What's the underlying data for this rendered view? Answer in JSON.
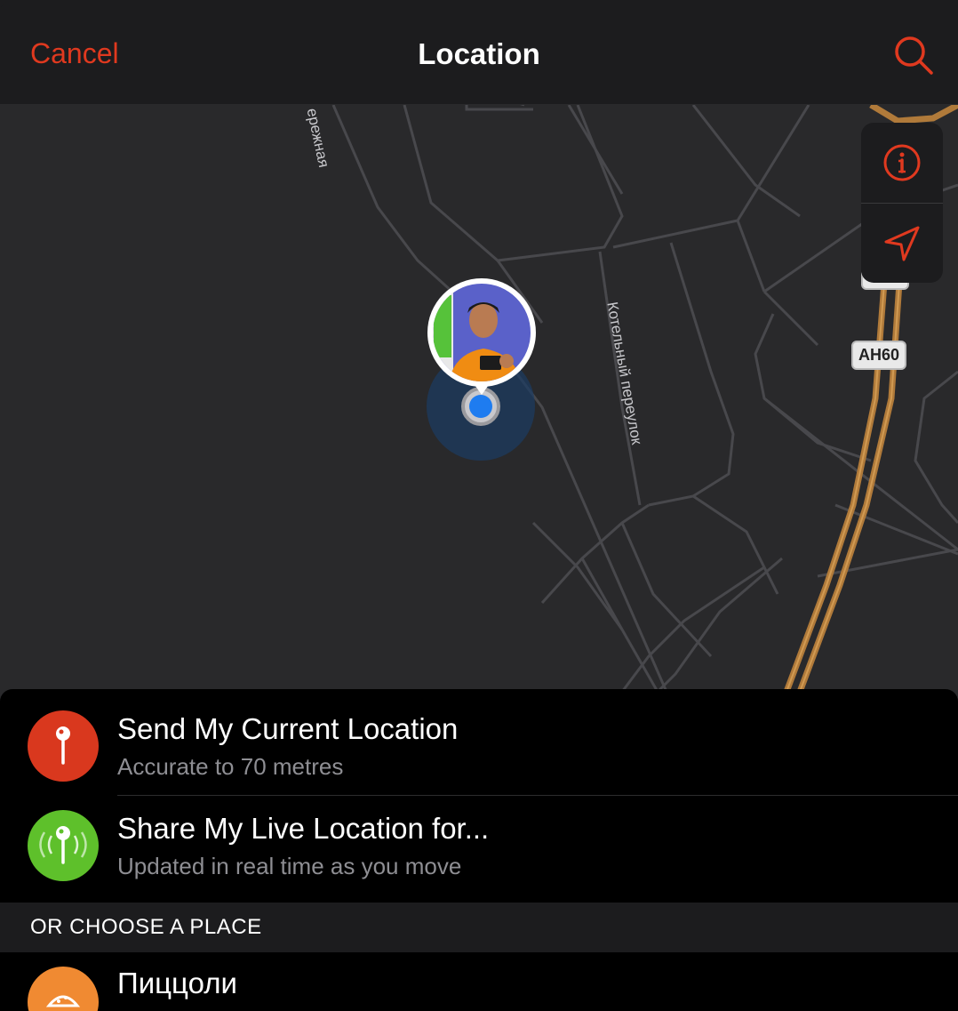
{
  "nav": {
    "cancel_label": "Cancel",
    "title": "Location",
    "search_icon": "search-icon"
  },
  "map": {
    "street_labels": [
      "ережная",
      "Котельный переулок"
    ],
    "road_badge": "AH60",
    "controls": [
      "info-icon",
      "location-arrow-icon"
    ],
    "accent_color": "#e0391f"
  },
  "actions": [
    {
      "label": "Send My Current Location",
      "sublabel": "Accurate to 70 metres",
      "icon": "pin-icon",
      "color": "#d9381e"
    },
    {
      "label": "Share My Live Location for...",
      "sublabel": "Updated in real time as you move",
      "icon": "live-location-icon",
      "color": "#5ec02b"
    }
  ],
  "places_header": "OR CHOOSE A PLACE",
  "places": [
    {
      "name": "Пиццоли",
      "icon": "pizza-icon",
      "color": "#f08a32"
    }
  ]
}
